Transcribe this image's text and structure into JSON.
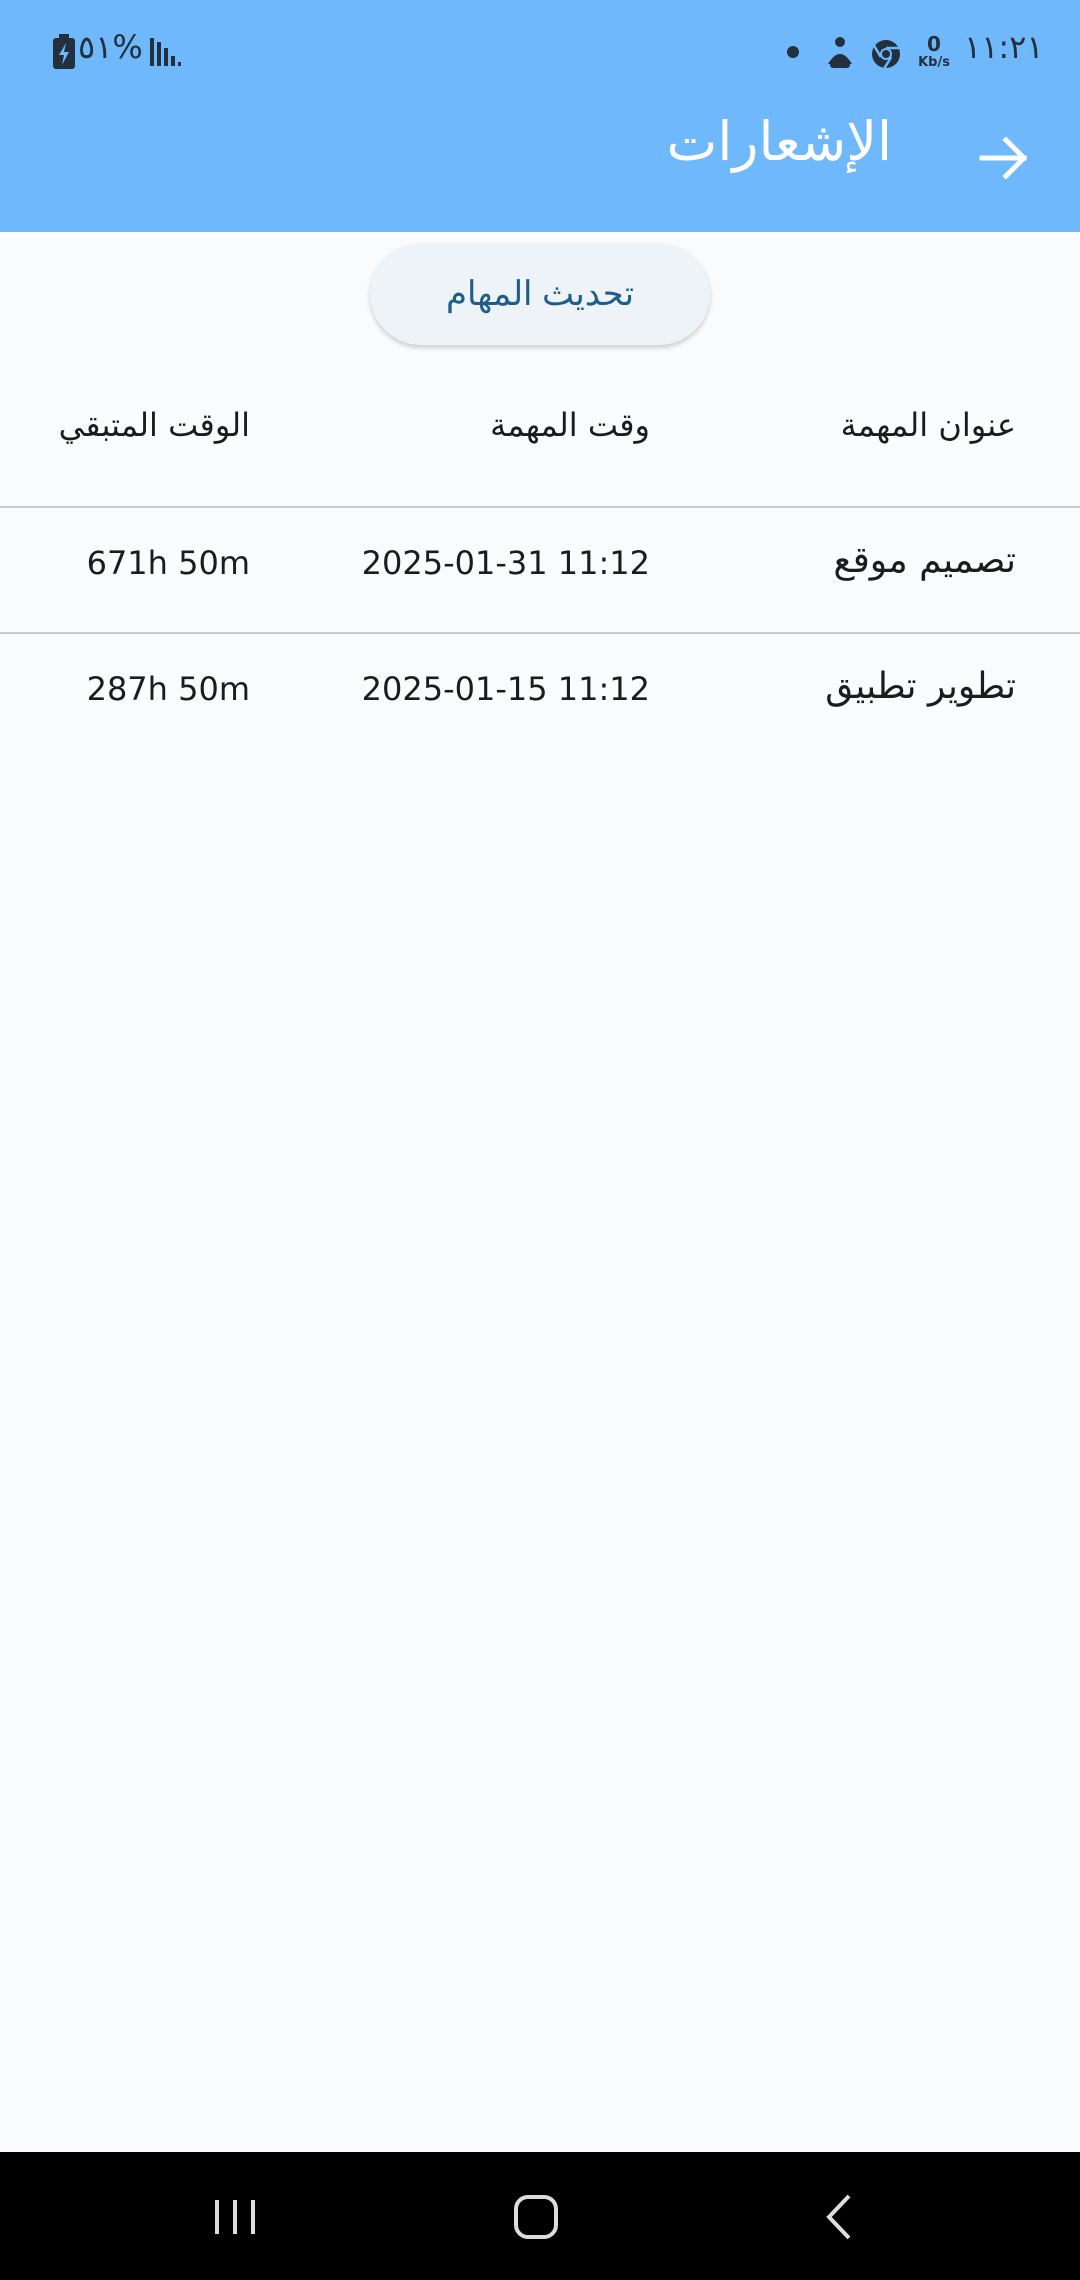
{
  "status_bar": {
    "time": "١١:٢١",
    "net_speed_value": "0",
    "net_speed_unit": "Kb/s",
    "battery_percent": "%٥١",
    "icons": [
      "dot-icon",
      "accessibility-icon",
      "chrome-icon",
      "signal-icon",
      "battery-icon"
    ]
  },
  "header": {
    "title": "الإشعارات",
    "back_icon": "arrow-right-icon",
    "background": "#6eb8fb"
  },
  "refresh_button": {
    "label": "تحديث المهام"
  },
  "table": {
    "headers": {
      "title": "عنوان المهمة",
      "time": "وقت المهمة",
      "remaining": "الوقت المتبقي"
    },
    "rows": [
      {
        "title": "تصميم موقع",
        "time": "2025-01-31 11:12",
        "remaining": "671h 50m"
      },
      {
        "title": "تطوير تطبيق",
        "time": "2025-01-15 11:12",
        "remaining": "287h 50m"
      }
    ]
  },
  "nav_bar": {
    "icons": [
      "recents-icon",
      "home-icon",
      "back-icon"
    ]
  }
}
